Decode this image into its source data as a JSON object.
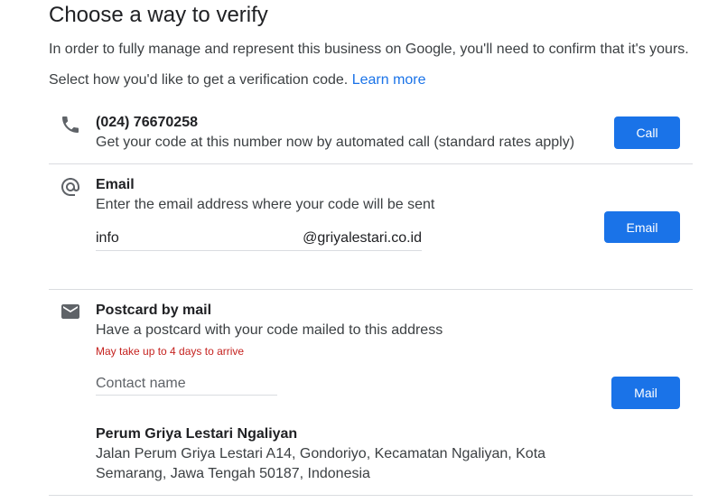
{
  "header": {
    "title": "Choose a way to verify",
    "intro": "In order to fully manage and represent this business on Google, you'll need to confirm that it's yours.",
    "select_text": "Select how you'd like to get a verification code.",
    "learn_more": "Learn more"
  },
  "options": {
    "phone": {
      "icon": "phone-icon",
      "number": "(024) 76670258",
      "description": "Get your code at this number now by automated call (standard rates apply)",
      "button": "Call"
    },
    "email": {
      "icon": "at-sign-icon",
      "title": "Email",
      "description": "Enter the email address where your code will be sent",
      "local_part": "info",
      "domain": "@griyalestari.co.id",
      "button": "Email"
    },
    "postcard": {
      "icon": "envelope-icon",
      "title": "Postcard by mail",
      "description": "Have a postcard with your code mailed to this address",
      "warning": "May take up to 4 days to arrive",
      "contact_placeholder": "Contact name",
      "button": "Mail",
      "address": {
        "name": "Perum Griya Lestari Ngaliyan",
        "line1": "Jalan Perum Griya Lestari A14, Gondoriyo, Kecamatan Ngaliyan, Kota",
        "line2": "Semarang, Jawa Tengah 50187, Indonesia"
      }
    }
  },
  "colors": {
    "accent": "#1a73e8",
    "warning": "#c5221f",
    "divider": "#dadce0",
    "icon": "#5f6368"
  }
}
